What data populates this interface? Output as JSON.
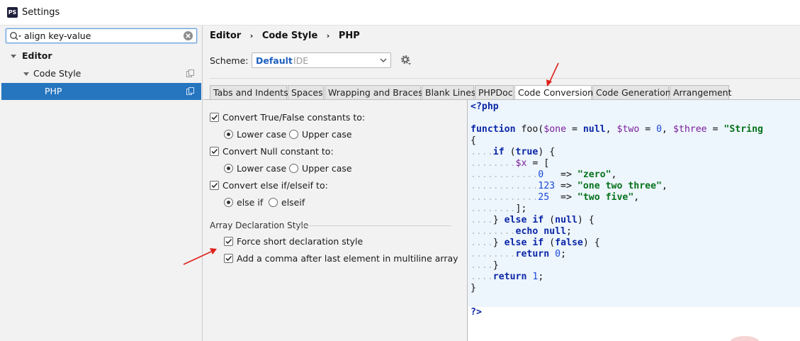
{
  "window": {
    "title": "Settings",
    "app_icon_text": "PS"
  },
  "search": {
    "value": "align key-value",
    "placeholder": ""
  },
  "tree": {
    "items": [
      {
        "label": "Editor",
        "bold": true
      },
      {
        "label": "Code Style",
        "bold": false
      },
      {
        "label": "PHP",
        "bold": false,
        "selected": true
      }
    ]
  },
  "breadcrumb": {
    "items": [
      "Editor",
      "Code Style",
      "PHP"
    ],
    "separator": "›"
  },
  "scheme": {
    "label": "Scheme:",
    "name": "Default",
    "sub": "IDE"
  },
  "tabs": [
    "Tabs and Indents",
    "Spaces",
    "Wrapping and Braces",
    "Blank Lines",
    "PHPDoc",
    "Code Conversion",
    "Code Generation",
    "Arrangement"
  ],
  "active_tab": "Code Conversion",
  "options": {
    "true_false": {
      "label": "Convert True/False constants to:",
      "checked": true,
      "lower": "Lower case",
      "upper": "Upper case",
      "selected": "lower"
    },
    "null_const": {
      "label": "Convert Null constant to:",
      "checked": true,
      "lower": "Lower case",
      "upper": "Upper case",
      "selected": "lower"
    },
    "else_if": {
      "label": "Convert else if/elseif to:",
      "checked": true,
      "opt1": "else if",
      "opt2": "elseif",
      "selected": "opt1"
    },
    "array_section": {
      "title": "Array Declaration Style"
    },
    "force_short": {
      "label": "Force short declaration style",
      "checked": true
    },
    "add_comma": {
      "label": "Add a comma after last element in multiline array",
      "checked": true
    }
  },
  "code": {
    "open_tag": "<?php",
    "close_tag": "?>",
    "lines": [
      "function foo($one = null, $two = 0, $three = \"String",
      "{",
      "if (true) {",
      "$x = [",
      "0   => \"zero\",",
      "123 => \"one two three\",",
      "25  => \"two five\",",
      "];",
      "} else if (null) {",
      "echo null;",
      "} else if (false) {",
      "return 0;",
      "}",
      "return 1;",
      "}"
    ]
  },
  "watermark_text": "",
  "colors": {
    "accent": "#2675bf",
    "arrow": "#e0201b",
    "code_bg": "#edf5fd",
    "keyword": "#0b27a6",
    "string": "#06721a",
    "variable": "#7a1e9a",
    "number": "#1b4bd8"
  }
}
